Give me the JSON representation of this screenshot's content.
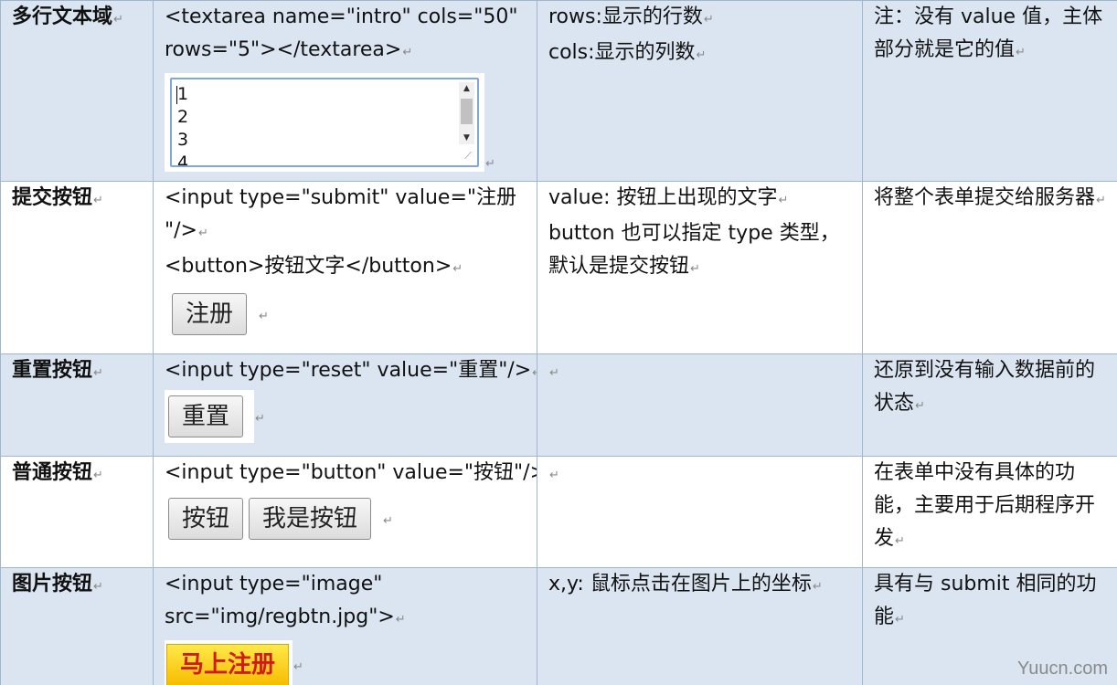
{
  "rows": [
    {
      "label": "多行文本域",
      "code_lines": [
        "<textarea name=\"intro\" cols=\"50\"",
        "rows=\"5\"></textarea>"
      ],
      "textarea_lines": [
        "1",
        "2",
        "3",
        "4"
      ],
      "attrs": [
        "rows:显示的行数",
        "cols:显示的列数"
      ],
      "note": "注：没有 value 值，主体部分就是它的值"
    },
    {
      "label": "提交按钮",
      "code_lines": [
        "<input type=\"submit\" value=\"注册",
        "\"/>",
        "<button>按钮文字</button>"
      ],
      "buttons": [
        "注册"
      ],
      "attrs": [
        "value: 按钮上出现的文字",
        "button 也可以指定 type 类型，默认是提交按钮"
      ],
      "note": "将整个表单提交给服务器"
    },
    {
      "label": "重置按钮",
      "code_lines": [
        "<input type=\"reset\" value=\"重置\"/>"
      ],
      "buttons": [
        "重置"
      ],
      "attrs": [],
      "note": "还原到没有输入数据前的状态"
    },
    {
      "label": "普通按钮",
      "code_lines": [
        "<input type=\"button\" value=\"按钮\"/>"
      ],
      "buttons": [
        "按钮",
        "我是按钮"
      ],
      "attrs": [],
      "note": "在表单中没有具体的功能，主要用于后期程序开发"
    },
    {
      "label": "图片按钮",
      "code_lines": [
        "<input type=\"image\"",
        "src=\"img/regbtn.jpg\">"
      ],
      "image_button": "马上注册",
      "attrs": [
        "x,y: 鼠标点击在图片上的坐标"
      ],
      "note": "具有与 submit 相同的功能"
    }
  ],
  "watermark": "Yuucn.com"
}
